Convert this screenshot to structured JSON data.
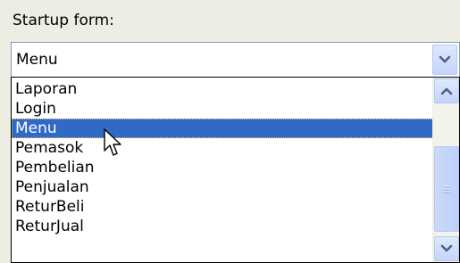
{
  "startup": {
    "label": "Startup form:",
    "selected_value": "Menu"
  },
  "dropdown": {
    "items": [
      {
        "label": "Laporan"
      },
      {
        "label": "Login"
      },
      {
        "label": "Menu",
        "selected": true
      },
      {
        "label": "Pemasok"
      },
      {
        "label": "Pembelian"
      },
      {
        "label": "Penjualan"
      },
      {
        "label": "ReturBeli"
      },
      {
        "label": "ReturJual"
      }
    ]
  },
  "icons": {
    "combo_button": "chevron-down-icon",
    "scroll_up": "chevron-up-icon",
    "scroll_down": "chevron-down-icon",
    "thumb_grip": "grip-icon",
    "pointer": "mouse-cursor-icon"
  },
  "colors": {
    "selection": "#316ac5",
    "combo_border": "#7f9db9",
    "arrow": "#4d6185",
    "background": "#eeede4"
  }
}
